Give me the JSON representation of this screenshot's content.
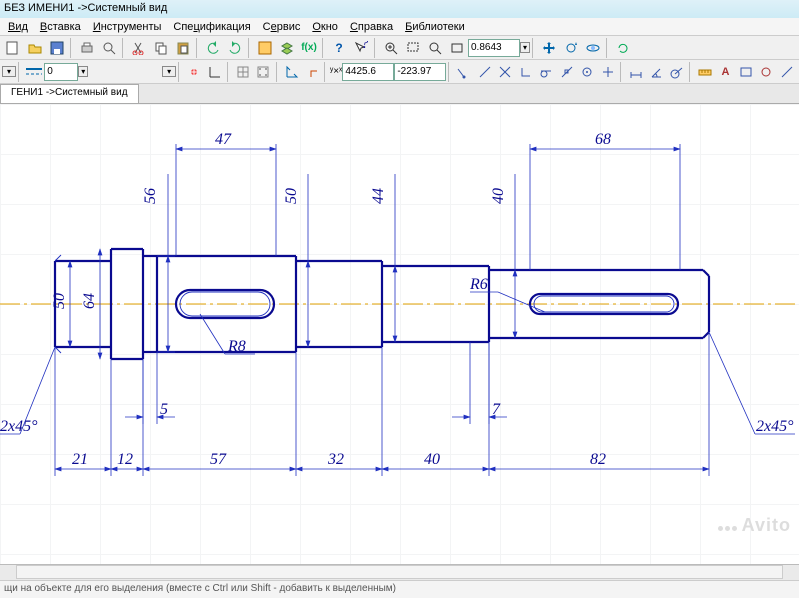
{
  "title": "БЕЗ ИМЕНИ1 ->Системный вид",
  "menu": {
    "items": [
      {
        "label": "Вид",
        "u": 0
      },
      {
        "label": "Вставка",
        "u": 0
      },
      {
        "label": "Инструменты",
        "u": 0
      },
      {
        "label": "Спецификация",
        "u": 0
      },
      {
        "label": "Сервис",
        "u": 1
      },
      {
        "label": "Окно",
        "u": 0
      },
      {
        "label": "Справка",
        "u": 0
      },
      {
        "label": "Библиотеки",
        "u": 0
      }
    ]
  },
  "toolbar1": {
    "zoom_value": "0.8643",
    "coord_x": "4425.6",
    "coord_y": "-223.97",
    "combo_value": "0"
  },
  "tab": {
    "label": "ГЕНИ1 ->Системный вид"
  },
  "statusbar": {
    "text": "щи на объекте для его выделения (вместе с Ctrl или Shift - добавить к выделенным)"
  },
  "watermark": "Avito",
  "drawing": {
    "dimensions": {
      "top_left": "47",
      "top_right": "68",
      "vert_56": "56",
      "vert_50b": "50",
      "vert_44": "44",
      "vert_40": "40",
      "vert_50a": "50",
      "vert_64": "64",
      "r8": "R8",
      "r6": "R6",
      "h_5": "5",
      "h_7": "7",
      "h_21": "21",
      "h_12": "12",
      "h_57": "57",
      "h_32": "32",
      "h_40": "40",
      "h_82": "82",
      "chamfer_left": "2x45°",
      "chamfer_right": "2x45°"
    }
  }
}
